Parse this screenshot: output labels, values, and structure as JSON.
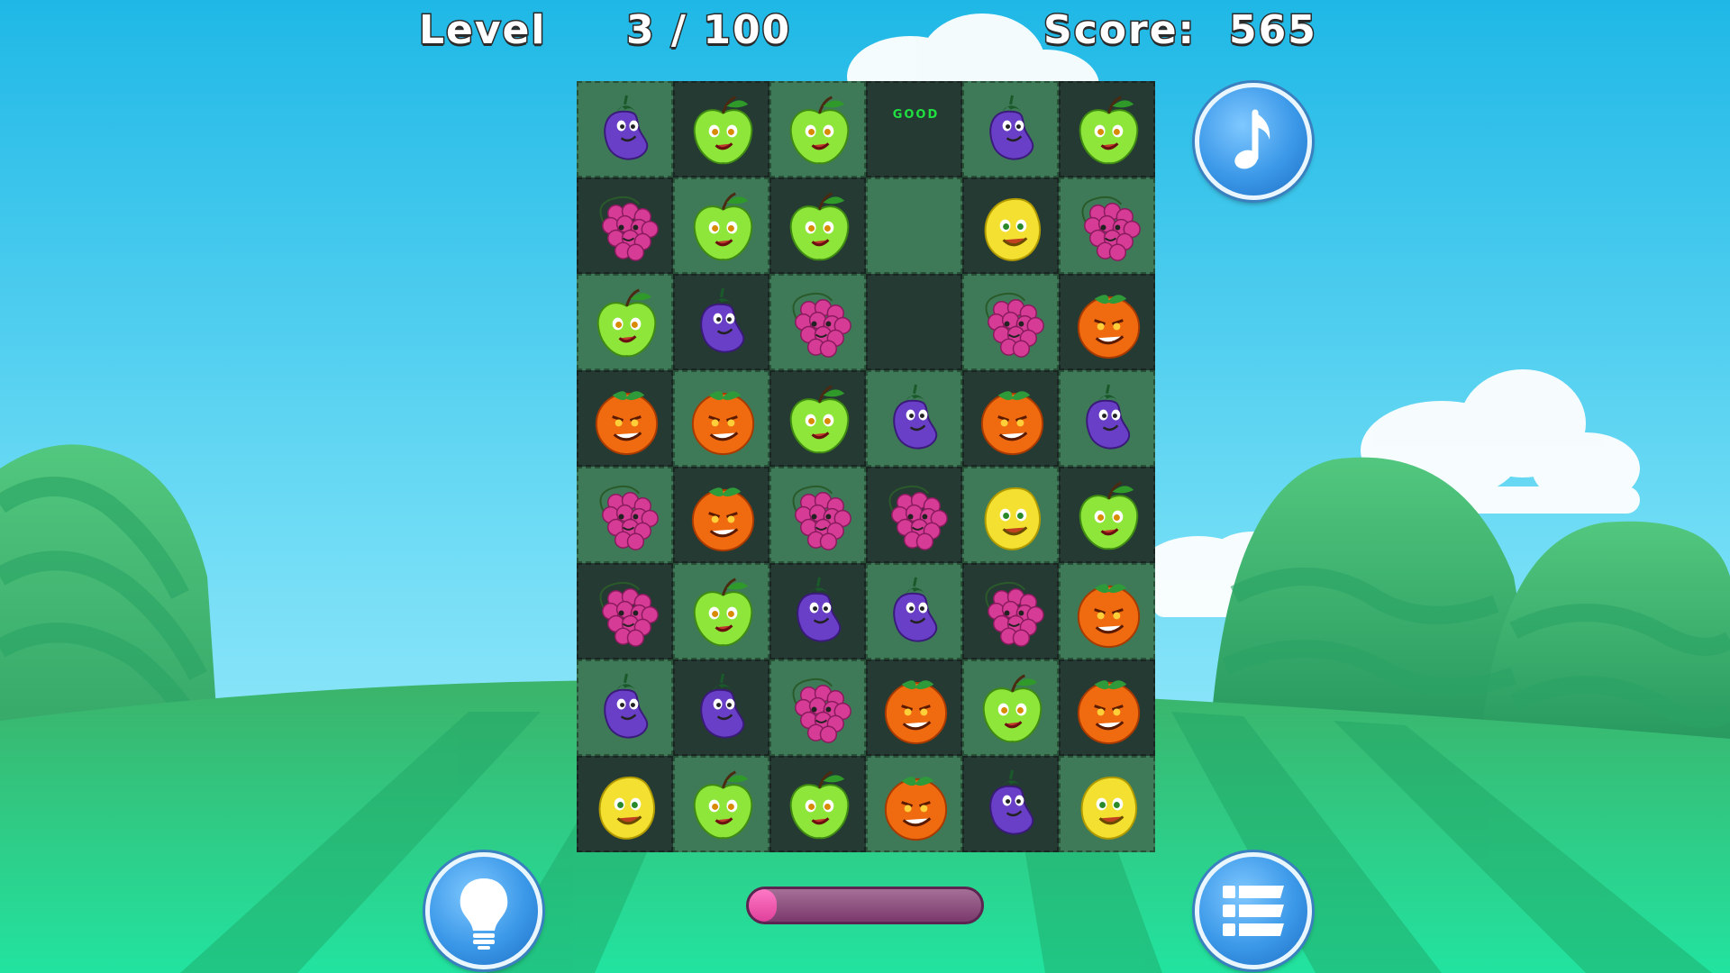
{
  "hud": {
    "level_label": "Level",
    "level_value": "3 / 100",
    "score_label": "Score:",
    "score_value": "565"
  },
  "combo_text": "GOOD",
  "progress": 0.12,
  "buttons": {
    "music": "music-note-icon",
    "hint": "lightbulb-icon",
    "menu": "menu-list-icon"
  },
  "colors": {
    "sky_top": "#1fb8e6",
    "sky_bottom": "#aef0ff",
    "tile_light": "#3e7a57",
    "tile_dark": "#263a34",
    "button_blue": "#3b98e8",
    "progress_pink": "#e0409a"
  },
  "board": {
    "columns": 6,
    "rows": 8,
    "grid": [
      [
        "eggplant",
        "apple",
        "apple",
        "empty-good",
        "eggplant",
        "apple"
      ],
      [
        "grapes",
        "apple",
        "apple",
        "empty",
        "lemon",
        "grapes"
      ],
      [
        "apple",
        "eggplant",
        "grapes",
        "empty",
        "grapes",
        "orange"
      ],
      [
        "orange",
        "orange",
        "apple",
        "eggplant",
        "orange",
        "eggplant"
      ],
      [
        "grapes",
        "orange",
        "grapes",
        "grapes",
        "lemon",
        "apple"
      ],
      [
        "grapes",
        "apple",
        "eggplant",
        "eggplant",
        "grapes",
        "orange"
      ],
      [
        "eggplant",
        "eggplant",
        "grapes",
        "orange",
        "apple",
        "orange"
      ],
      [
        "lemon",
        "apple",
        "apple",
        "orange",
        "eggplant",
        "lemon"
      ]
    ]
  }
}
